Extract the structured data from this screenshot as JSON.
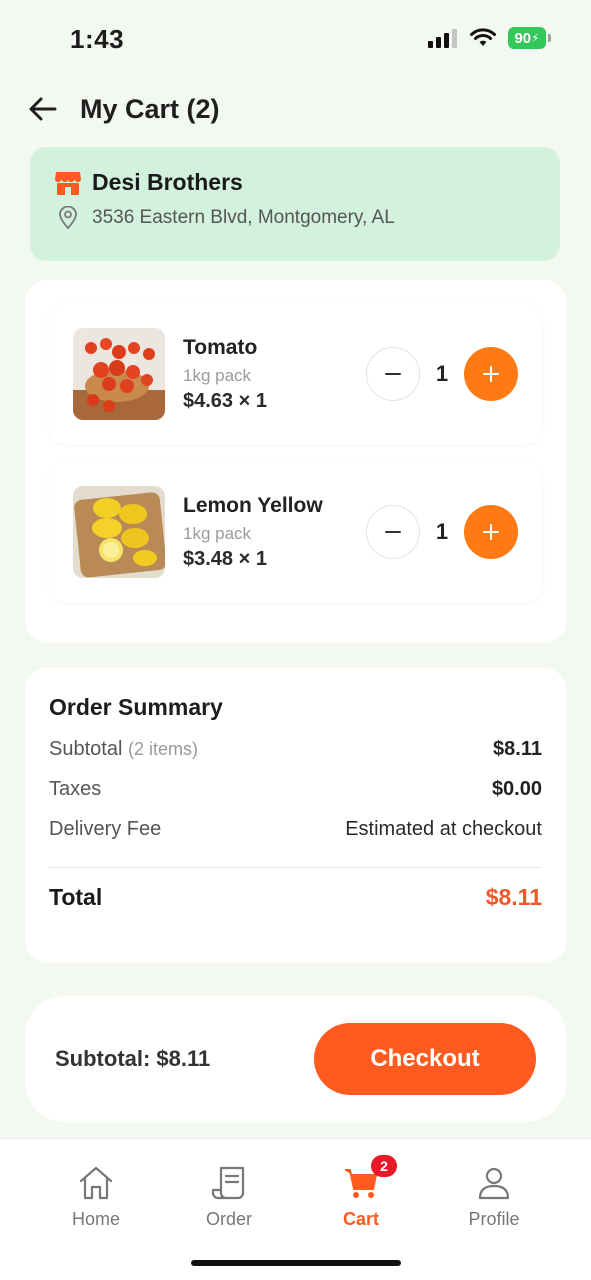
{
  "status_bar": {
    "time": "1:43",
    "battery": "90"
  },
  "header": {
    "title": "My Cart (2)"
  },
  "store": {
    "name": "Desi Brothers",
    "address": "3536 Eastern Blvd, Montgomery, AL"
  },
  "items": [
    {
      "name": "Tomato",
      "pack": "1kg pack",
      "price_line": "$4.63 × 1",
      "quantity": "1",
      "image": "tomato-image"
    },
    {
      "name": "Lemon Yellow",
      "pack": "1kg pack",
      "price_line": "$3.48 × 1",
      "quantity": "1",
      "image": "lemon-image"
    }
  ],
  "summary": {
    "title": "Order Summary",
    "subtotal_label": "Subtotal",
    "subtotal_items": "(2 items)",
    "subtotal_value": "$8.11",
    "taxes_label": "Taxes",
    "taxes_value": "$0.00",
    "delivery_label": "Delivery Fee",
    "delivery_value": "Estimated at checkout",
    "total_label": "Total",
    "total_value": "$8.11"
  },
  "checkout": {
    "subtotal_text": "Subtotal: $8.11",
    "button_label": "Checkout"
  },
  "tabs": [
    {
      "label": "Home",
      "icon": "home-icon"
    },
    {
      "label": "Order",
      "icon": "receipt-icon"
    },
    {
      "label": "Cart",
      "icon": "cart-icon",
      "badge": "2",
      "active": true
    },
    {
      "label": "Profile",
      "icon": "person-icon"
    }
  ],
  "colors": {
    "accent": "#ff5a1f",
    "plus_button": "#ff7a12",
    "store_bg": "#d3f2dd",
    "badge": "#e8182a",
    "total": "#f0572a"
  }
}
